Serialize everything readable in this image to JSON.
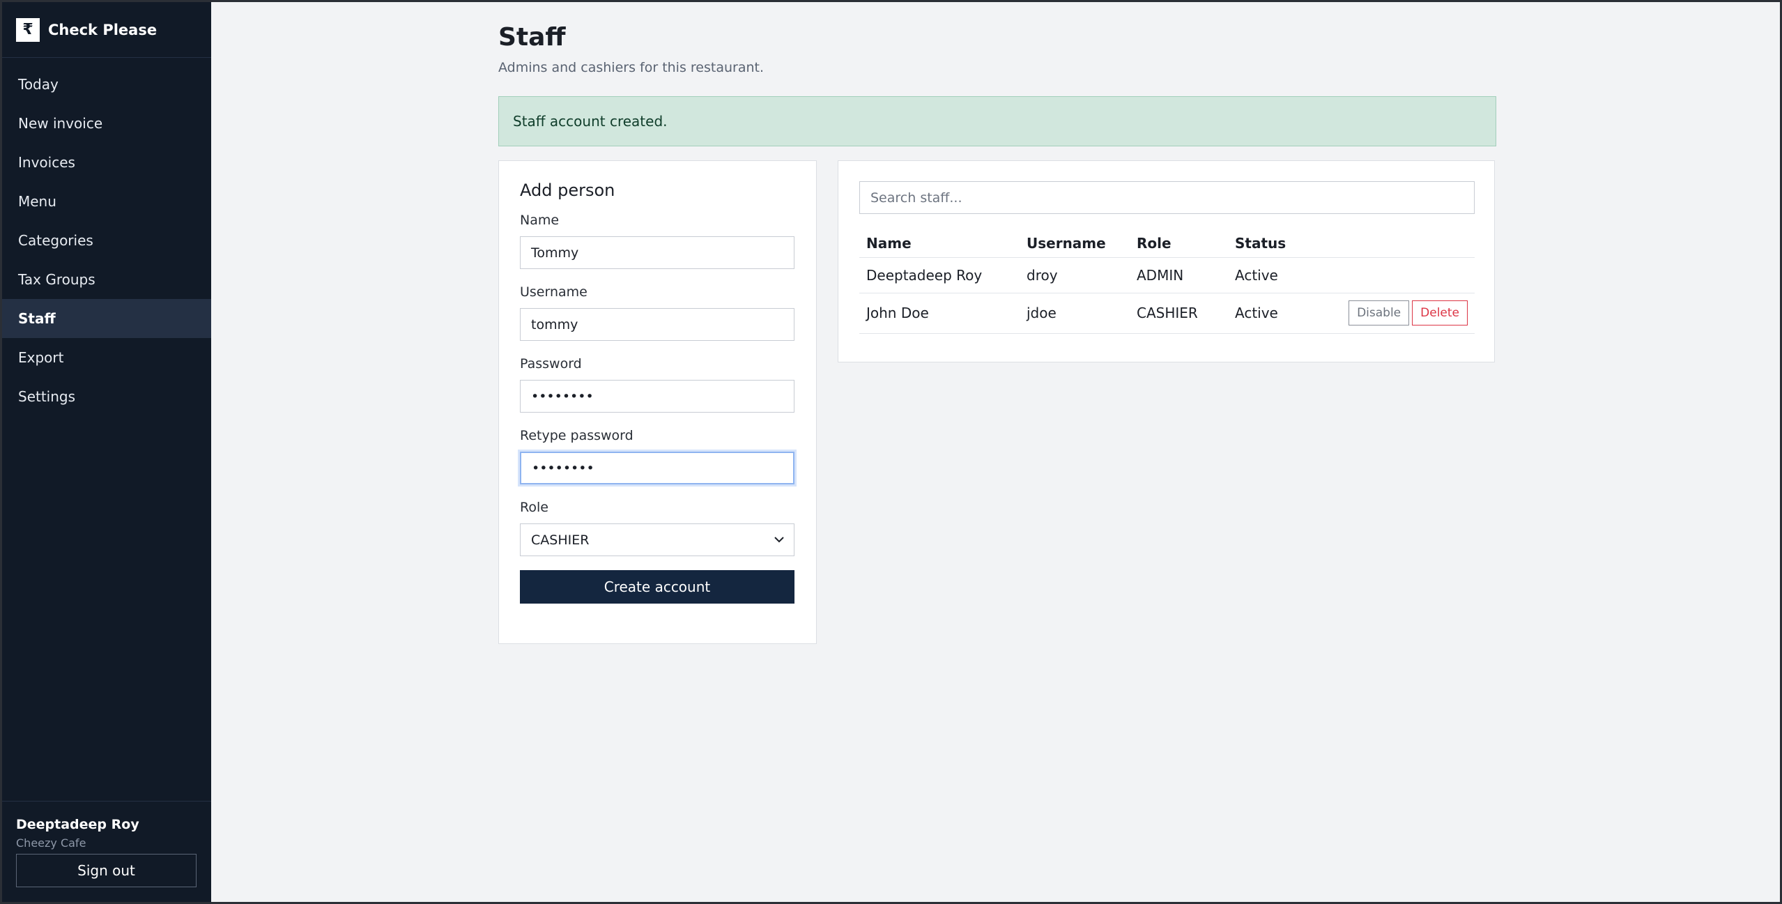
{
  "brand": {
    "logo_glyph": "₹",
    "name": "Check Please"
  },
  "nav": [
    {
      "label": "Today"
    },
    {
      "label": "New invoice"
    },
    {
      "label": "Invoices"
    },
    {
      "label": "Menu"
    },
    {
      "label": "Categories"
    },
    {
      "label": "Tax Groups"
    },
    {
      "label": "Staff",
      "active": true
    },
    {
      "label": "Export"
    },
    {
      "label": "Settings"
    }
  ],
  "user": {
    "name": "Deeptadeep Roy",
    "org": "Cheezy Cafe",
    "signout_label": "Sign out"
  },
  "page": {
    "title": "Staff",
    "subtitle": "Admins and cashiers for this restaurant."
  },
  "alert": {
    "message": "Staff account created.",
    "color": "#d1e7dd"
  },
  "form": {
    "title": "Add person",
    "name_label": "Name",
    "name_value": "Tommy",
    "username_label": "Username",
    "username_value": "tommy",
    "password_label": "Password",
    "password_value": "••••••••",
    "retype_label": "Retype password",
    "retype_value": "••••••••",
    "role_label": "Role",
    "role_value": "CASHIER",
    "submit_label": "Create account"
  },
  "staff": {
    "search_placeholder": "Search staff...",
    "columns": [
      "Name",
      "Username",
      "Role",
      "Status"
    ],
    "rows": [
      {
        "name": "Deeptadeep Roy",
        "username": "droy",
        "role": "ADMIN",
        "status": "Active"
      },
      {
        "name": "John Doe",
        "username": "jdoe",
        "role": "CASHIER",
        "status": "Active",
        "disable_label": "Disable",
        "delete_label": "Delete"
      }
    ]
  },
  "colors": {
    "sidebar": "#111a27",
    "primary_button": "#14263f",
    "danger": "#dc3545"
  }
}
